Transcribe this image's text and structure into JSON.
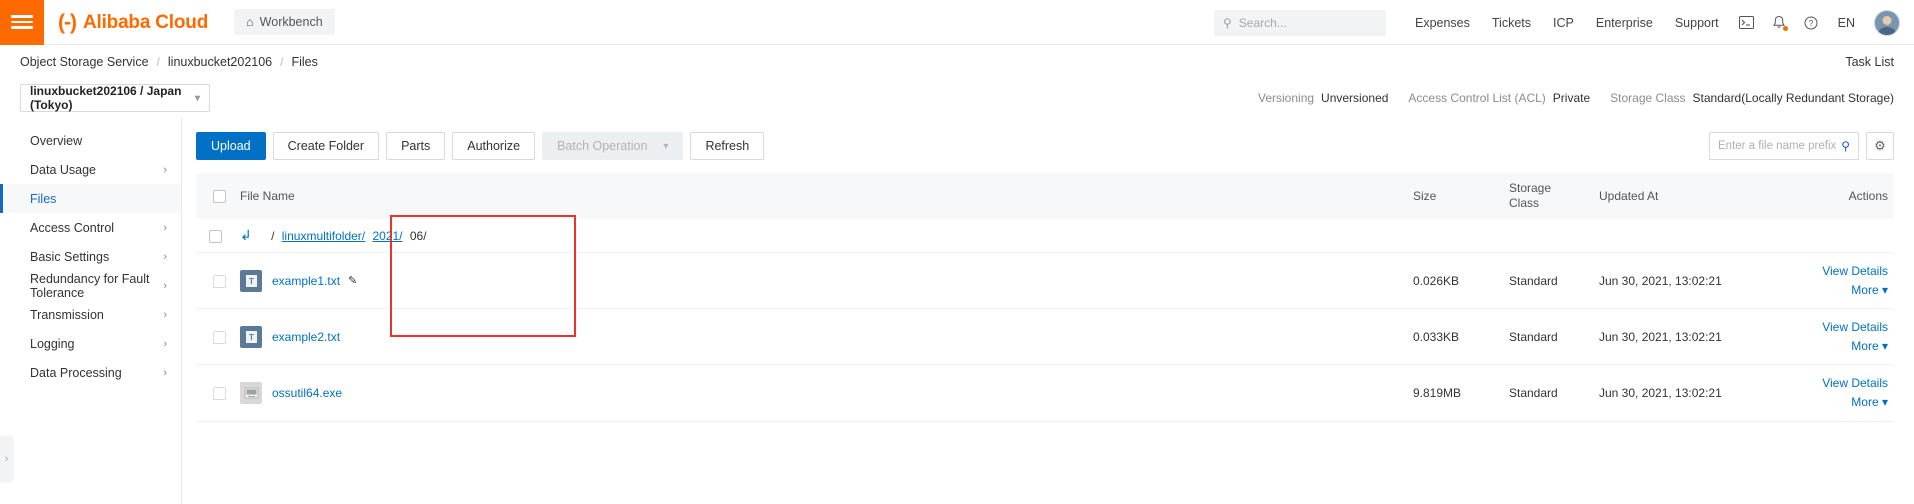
{
  "topnav": {
    "menu_icon": "hamburger-icon",
    "brand_mark": "(-)",
    "brand_name": "Alibaba Cloud",
    "workbench_label": "Workbench",
    "workbench_icon": "home-icon",
    "search_placeholder": "Search...",
    "search_value": "",
    "search_icon": "search-icon",
    "links": [
      "Expenses",
      "Tickets",
      "ICP",
      "Enterprise",
      "Support"
    ],
    "console_icon": "console-terminal-icon",
    "bell_icon": "notification-bell-icon",
    "help_icon": "help-question-icon",
    "language": "EN",
    "avatar_icon": "user-avatar"
  },
  "breadcrumb": {
    "items": [
      "Object Storage Service",
      "linuxbucket202106",
      "Files"
    ],
    "separator": "/",
    "task_list_label": "Task List"
  },
  "subbar": {
    "bucket_label": "linuxbucket202106 / Japan (Tokyo)",
    "bucket_chevron": "chevron-down-icon",
    "meta": [
      {
        "label": "Versioning",
        "value": "Unversioned"
      },
      {
        "label": "Access Control List (ACL)",
        "value": "Private"
      },
      {
        "label": "Storage Class",
        "value": "Standard(Locally Redundant Storage)"
      }
    ]
  },
  "sidebar": {
    "items": [
      {
        "label": "Overview",
        "has_chevron": false,
        "active": false
      },
      {
        "label": "Data Usage",
        "has_chevron": true,
        "active": false
      },
      {
        "label": "Files",
        "has_chevron": false,
        "active": true
      },
      {
        "label": "Access Control",
        "has_chevron": true,
        "active": false
      },
      {
        "label": "Basic Settings",
        "has_chevron": true,
        "active": false
      },
      {
        "label": "Redundancy for Fault Tolerance",
        "has_chevron": true,
        "active": false
      },
      {
        "label": "Transmission",
        "has_chevron": true,
        "active": false
      },
      {
        "label": "Logging",
        "has_chevron": true,
        "active": false
      },
      {
        "label": "Data Processing",
        "has_chevron": true,
        "active": false
      }
    ],
    "collapse_icon": "chevron-right-icon"
  },
  "toolbar": {
    "upload_label": "Upload",
    "create_folder_label": "Create Folder",
    "parts_label": "Parts",
    "authorize_label": "Authorize",
    "batch_operation_label": "Batch Operation",
    "batch_chevron": "chevron-down-icon",
    "refresh_label": "Refresh",
    "prefix_placeholder": "Enter a file name prefix",
    "prefix_value": "",
    "prefix_search_icon": "search-icon",
    "settings_icon": "gear-icon"
  },
  "table": {
    "headers": {
      "file_name": "File Name",
      "size": "Size",
      "storage_class": "Storage\nClass",
      "storage_class_line1": "Storage",
      "storage_class_line2": "Class",
      "updated_at": "Updated At",
      "actions": "Actions"
    },
    "path_row": {
      "back_icon": "back-arrow-icon",
      "root": "/",
      "segments": [
        {
          "text": "linuxmultifolder/",
          "link": true
        },
        {
          "text": "2021/",
          "link": true
        },
        {
          "text": "06/",
          "link": false
        }
      ]
    },
    "rows": [
      {
        "icon": "txt-file-icon",
        "icon_kind": "txt",
        "icon_glyph": "T",
        "name": "example1.txt",
        "has_pencil": true,
        "pencil_icon": "edit-pencil-icon",
        "size": "0.026KB",
        "storage_class": "Standard",
        "updated_at": "Jun 30, 2021, 13:02:21",
        "view_details": "View Details",
        "more": "More"
      },
      {
        "icon": "txt-file-icon",
        "icon_kind": "txt",
        "icon_glyph": "T",
        "name": "example2.txt",
        "has_pencil": false,
        "pencil_icon": "",
        "size": "0.033KB",
        "storage_class": "Standard",
        "updated_at": "Jun 30, 2021, 13:02:21",
        "view_details": "View Details",
        "more": "More"
      },
      {
        "icon": "exe-file-icon",
        "icon_kind": "exe",
        "icon_glyph": "⚙",
        "name": "ossutil64.exe",
        "has_pencil": false,
        "pencil_icon": "",
        "size": "9.819MB",
        "storage_class": "Standard",
        "updated_at": "Jun 30, 2021, 13:02:21",
        "view_details": "View Details",
        "more": "More"
      }
    ]
  },
  "annotation": {
    "kind": "red-rectangle-highlight",
    "color": "#e8342a"
  },
  "colors": {
    "brand_orange": "#ff6a00",
    "link_blue": "#0071c5",
    "primary_button": "#0071c5",
    "annotation_red": "#e8342a"
  }
}
